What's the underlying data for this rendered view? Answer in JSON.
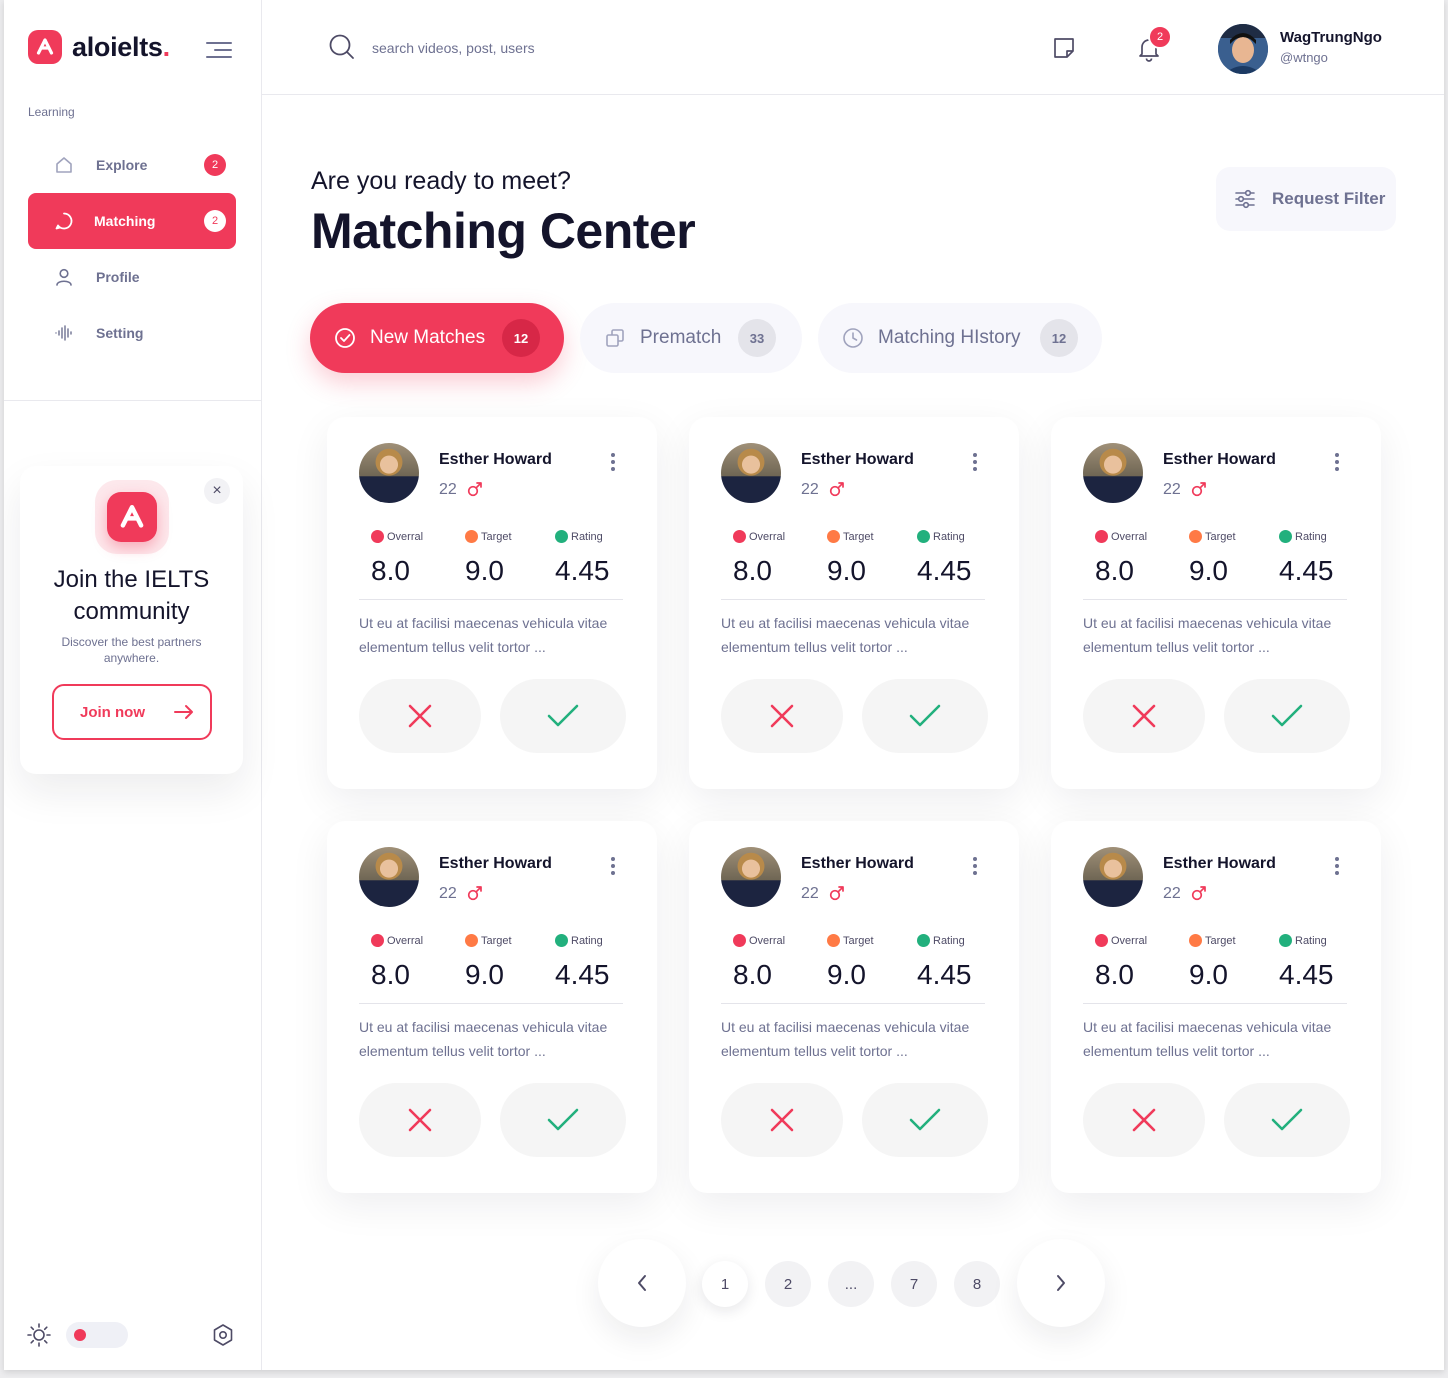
{
  "brand": {
    "name": "aloielts",
    "dot": ".",
    "accent": "#f03a5a"
  },
  "sidebar": {
    "section_label": "Learning",
    "items": [
      {
        "label": "Explore",
        "badge": "2",
        "icon": "home-icon"
      },
      {
        "label": "Matching",
        "badge": "2",
        "icon": "chat-icon",
        "active": true
      },
      {
        "label": "Profile",
        "icon": "user-icon"
      },
      {
        "label": "Setting",
        "icon": "soundwave-icon"
      }
    ],
    "promo": {
      "title": "Join the IELTS community",
      "subtitle": "Discover the best partners anywhere.",
      "button": "Join now",
      "close": "×"
    }
  },
  "topbar": {
    "search_placeholder": "search videos, post, users",
    "notifications_count": "2",
    "user": {
      "name": "WagTrungNgo",
      "handle": "@wtngo"
    }
  },
  "main": {
    "kicker": "Are you ready to meet?",
    "title": "Matching Center",
    "filter_button": "Request Filter",
    "tabs": [
      {
        "label": "New Matches",
        "count": "12",
        "active": true
      },
      {
        "label": "Prematch",
        "count": "33"
      },
      {
        "label": "Matching HIstory",
        "count": "12"
      }
    ],
    "stat_labels": {
      "overall": "Overral",
      "target": "Target",
      "rating": "Rating"
    },
    "stat_colors": {
      "overall": "#f03a5a",
      "target": "#ff7a45",
      "rating": "#22b07d"
    },
    "cards": [
      {
        "name": "Esther Howard",
        "age": "22",
        "overall": "8.0",
        "target": "9.0",
        "rating": "4.45",
        "desc": "Ut eu at facilisi maecenas vehicula vitae elementum tellus velit tortor ..."
      },
      {
        "name": "Esther Howard",
        "age": "22",
        "overall": "8.0",
        "target": "9.0",
        "rating": "4.45",
        "desc": "Ut eu at facilisi maecenas vehicula vitae elementum tellus velit tortor ..."
      },
      {
        "name": "Esther Howard",
        "age": "22",
        "overall": "8.0",
        "target": "9.0",
        "rating": "4.45",
        "desc": "Ut eu at facilisi maecenas vehicula vitae elementum tellus velit tortor ..."
      },
      {
        "name": "Esther Howard",
        "age": "22",
        "overall": "8.0",
        "target": "9.0",
        "rating": "4.45",
        "desc": "Ut eu at facilisi maecenas vehicula vitae elementum tellus velit tortor ..."
      },
      {
        "name": "Esther Howard",
        "age": "22",
        "overall": "8.0",
        "target": "9.0",
        "rating": "4.45",
        "desc": "Ut eu at facilisi maecenas vehicula vitae elementum tellus velit tortor ..."
      },
      {
        "name": "Esther Howard",
        "age": "22",
        "overall": "8.0",
        "target": "9.0",
        "rating": "4.45",
        "desc": "Ut eu at facilisi maecenas vehicula vitae elementum tellus velit tortor ..."
      }
    ]
  },
  "pagination": {
    "pages": [
      "1",
      "2",
      "...",
      "7",
      "8"
    ],
    "current": "1"
  }
}
